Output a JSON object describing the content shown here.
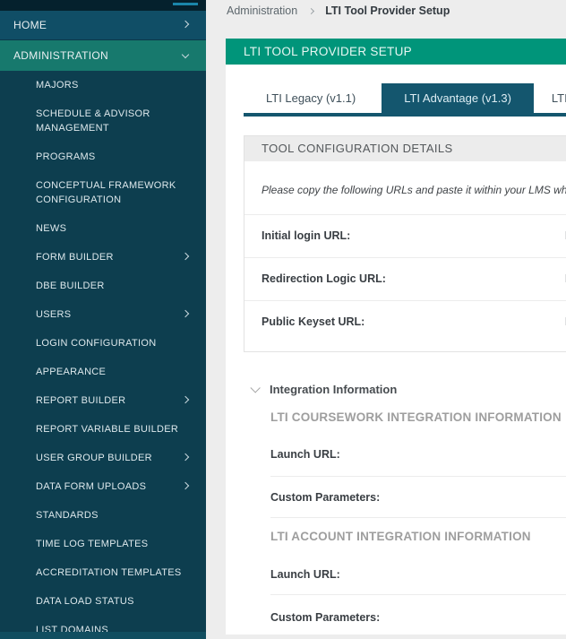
{
  "sidebar": {
    "items": [
      {
        "label": "HOME",
        "level": "top",
        "chevron": "right"
      },
      {
        "label": "ADMINISTRATION",
        "level": "top",
        "chevron": "down",
        "active": true
      },
      {
        "label": "MAJORS"
      },
      {
        "label": "SCHEDULE & ADVISOR MANAGEMENT"
      },
      {
        "label": "PROGRAMS"
      },
      {
        "label": "CONCEPTUAL FRAMEWORK CONFIGURATION"
      },
      {
        "label": "NEWS"
      },
      {
        "label": "FORM BUILDER",
        "chevron": "right"
      },
      {
        "label": "DBE BUILDER"
      },
      {
        "label": "USERS",
        "chevron": "right"
      },
      {
        "label": "LOGIN CONFIGURATION"
      },
      {
        "label": "APPEARANCE"
      },
      {
        "label": "REPORT BUILDER",
        "chevron": "right"
      },
      {
        "label": "REPORT VARIABLE BUILDER"
      },
      {
        "label": "USER GROUP BUILDER",
        "chevron": "right"
      },
      {
        "label": "DATA FORM UPLOADS",
        "chevron": "right"
      },
      {
        "label": "STANDARDS"
      },
      {
        "label": "TIME LOG TEMPLATES"
      },
      {
        "label": "ACCREDITATION TEMPLATES"
      },
      {
        "label": "DATA LOAD STATUS"
      },
      {
        "label": "LIST DOMAINS"
      }
    ]
  },
  "breadcrumb": {
    "parent": "Administration",
    "current": "LTI Tool Provider Setup"
  },
  "page": {
    "title": "LTI TOOL PROVIDER SETUP"
  },
  "tabs": [
    {
      "label": "LTI Legacy (v1.1)",
      "active": false
    },
    {
      "label": "LTI Advantage (v1.3)",
      "active": true
    },
    {
      "label": "LTI L",
      "active": false,
      "clipped_at_right_edge": true
    }
  ],
  "tool_config": {
    "heading": "TOOL CONFIGURATION DETAILS",
    "note": "Please copy the following URLs and paste it within your LMS when",
    "rows": [
      {
        "label": "Initial login URL:",
        "value_fragment": "h"
      },
      {
        "label": "Redirection Logic URL:",
        "value_fragment": "h"
      },
      {
        "label": "Public Keyset URL:",
        "value_fragment": "h"
      }
    ]
  },
  "integration": {
    "toggle_label": "Integration Information",
    "sections": [
      {
        "heading": "LTI COURSEWORK INTEGRATION INFORMATION",
        "rows": [
          {
            "label": "Launch URL:"
          },
          {
            "label": "Custom Parameters:"
          }
        ]
      },
      {
        "heading": "LTI ACCOUNT INTEGRATION INFORMATION",
        "rows": [
          {
            "label": "Launch URL:"
          },
          {
            "label": "Custom Parameters:"
          }
        ]
      }
    ]
  },
  "colors": {
    "sidebar_bg": "#0d3e4f",
    "sidebar_topbar_bg": "#05212d",
    "sidebar_home_bg": "#104e66",
    "sidebar_active_item_bg": "#17796d",
    "sidebar_bottom_peek_bg": "#114e60",
    "hamburger_accent": "#1b86aa",
    "banner_bg": "#00957a",
    "active_tab_bg": "#14566e",
    "page_bg": "#ededed",
    "card_bg": "#ffffff",
    "section_header_bg": "#ececec"
  }
}
